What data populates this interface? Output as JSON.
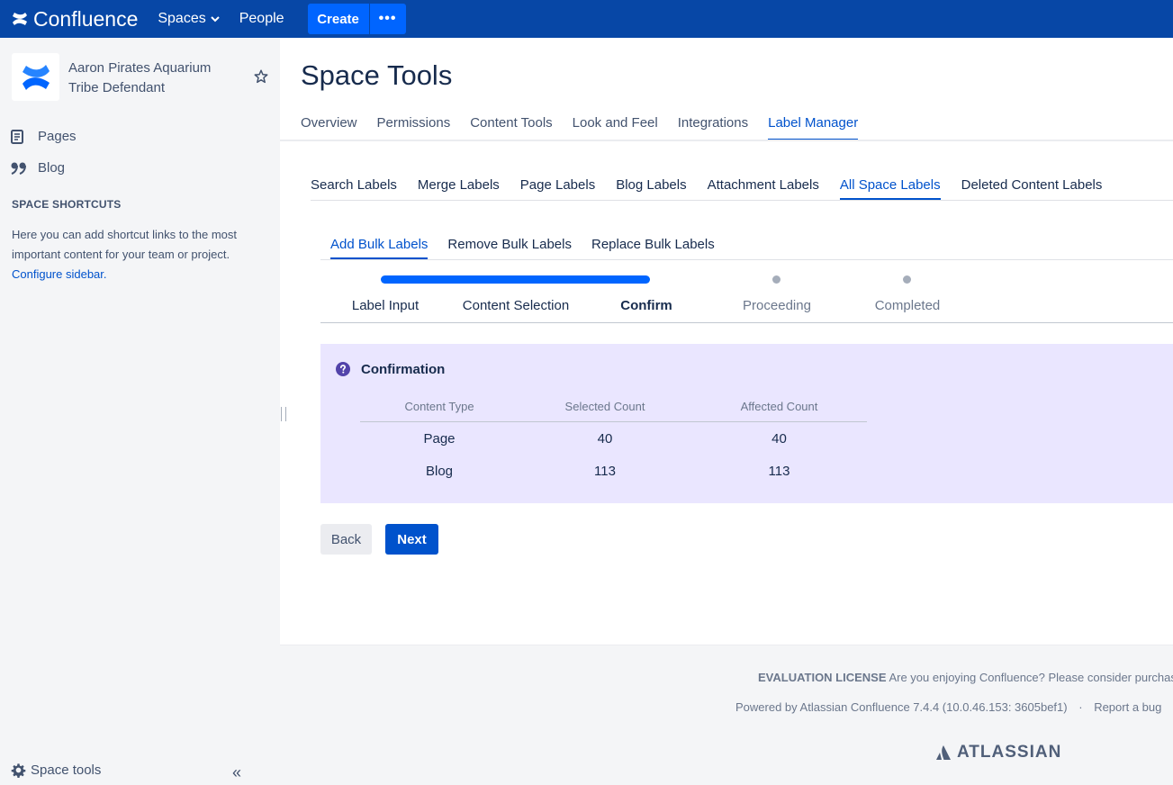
{
  "topnav": {
    "product": "Confluence",
    "spaces_label": "Spaces",
    "people_label": "People",
    "create_label": "Create",
    "more_label": "•••"
  },
  "sidebar": {
    "space_name": "Aaron Pirates Aquarium Tribe Defendant",
    "items": [
      {
        "label": "Pages",
        "icon": "pages-icon"
      },
      {
        "label": "Blog",
        "icon": "blog-quote-icon"
      }
    ],
    "shortcuts_heading": "SPACE SHORTCUTS",
    "shortcuts_text": "Here you can add shortcut links to the most important content for your team or project.",
    "configure_link": "Configure sidebar.",
    "space_tools_label": "Space tools",
    "collapse_label": "«"
  },
  "page": {
    "title": "Space Tools",
    "tabs": [
      "Overview",
      "Permissions",
      "Content Tools",
      "Look and Feel",
      "Integrations",
      "Label Manager"
    ],
    "active_tab": "Label Manager",
    "label_tabs": [
      "Search Labels",
      "Merge Labels",
      "Page Labels",
      "Blog Labels",
      "Attachment Labels",
      "All Space Labels",
      "Deleted Content Labels"
    ],
    "active_label_tab": "All Space Labels",
    "bulk_tabs": [
      "Add Bulk Labels",
      "Remove Bulk Labels",
      "Replace Bulk Labels"
    ],
    "active_bulk_tab": "Add Bulk Labels"
  },
  "tracker": {
    "steps": [
      "Label Input",
      "Content Selection",
      "Confirm",
      "Proceeding",
      "Completed"
    ],
    "current_step": "Confirm"
  },
  "confirmation": {
    "title": "Confirmation",
    "headers": [
      "Content Type",
      "Selected Count",
      "Affected Count"
    ],
    "rows": [
      [
        "Page",
        "40",
        "40"
      ],
      [
        "Blog",
        "113",
        "113"
      ]
    ]
  },
  "actions": {
    "back_label": "Back",
    "next_label": "Next"
  },
  "footer": {
    "license_bold": "EVALUATION LICENSE",
    "license_text": "Are you enjoying Confluence? Please consider purchasing it today.",
    "powered_by": "Powered by Atlassian Confluence 7.4.4 (10.0.46.153: 3605bef1)",
    "separator": "·",
    "report_bug": "Report a bug",
    "brand": "ATLASSIAN"
  },
  "colors": {
    "nav_bg": "#0747a6",
    "accent": "#0052cc",
    "create_btn": "#0065ff",
    "panel_bg": "#eae6ff",
    "sidebar_bg": "#f4f5f7"
  }
}
